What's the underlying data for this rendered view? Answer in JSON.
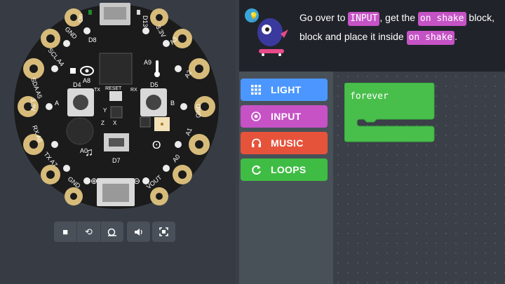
{
  "board": {
    "labels": {
      "on": "On",
      "d13": "D13",
      "d8": "D8",
      "gnd_top_left": "GND",
      "v33_top_right": "3.3V",
      "scl_a4": "SCL A4",
      "a3": "A3",
      "a8": "A8",
      "a9": "A9",
      "a2": "A2",
      "sda_a5": "SDA A5",
      "d4": "D4",
      "d5": "D5",
      "tx_small": "TX",
      "rx_small": "RX",
      "reset": "RESET",
      "a_btn": "A",
      "b_btn": "B",
      "v33_left": "3.3V",
      "gnd_right": "GND",
      "a1": "A1",
      "rx_a6": "RX A6",
      "a0_label": "A0",
      "d7": "D7",
      "tx_a7": "TX A7",
      "a0_right": "A0",
      "gnd_bottom_left": "GND",
      "vout": "VOUT",
      "y_axis": "Y",
      "z_axis": "Z",
      "x_axis": "X"
    }
  },
  "controls": {
    "stop_icon": "■",
    "restart_icon": "⟲",
    "slowmo_icon": "🐌",
    "mute_icon": "🔊",
    "fullscreen_icon": "⛶"
  },
  "tutorial": {
    "part1": "Go over to ",
    "chip1": "INPUT",
    "part2": ", get the ",
    "chip2": "on shake",
    "part3": " block,",
    "line2_part1": "block and place it inside ",
    "chip3": "on shake",
    "line2_part2": "."
  },
  "toolbox": {
    "categories": [
      {
        "label": "LIGHT",
        "color": "#4c97ff",
        "icon": "grid-icon"
      },
      {
        "label": "INPUT",
        "color": "#c652c6",
        "icon": "target-icon"
      },
      {
        "label": "MUSIC",
        "color": "#e6533b",
        "icon": "headphones-icon"
      },
      {
        "label": "LOOPS",
        "color": "#3fbc44",
        "icon": "refresh-icon"
      }
    ]
  },
  "workspace": {
    "block_label": "forever",
    "block_color": "#48bf4b"
  }
}
